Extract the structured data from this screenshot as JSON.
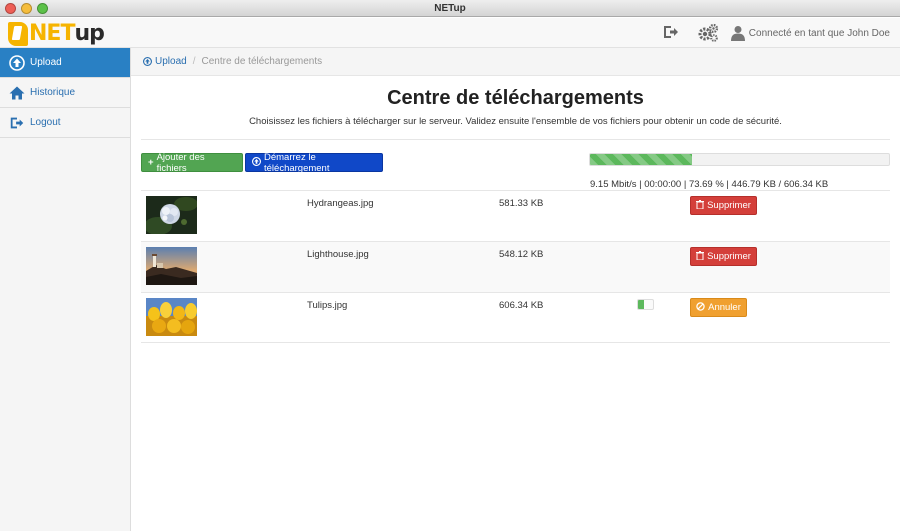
{
  "window": {
    "title": "NETup"
  },
  "header": {
    "logo_a": "NET",
    "logo_b": "up",
    "user_text": "Connecté en tant que John Doe",
    "icons": [
      "logout-icon",
      "gears-icon",
      "user-icon"
    ]
  },
  "sidebar": {
    "items": [
      {
        "label": "Upload",
        "icon": "upload-circle-icon",
        "active": true
      },
      {
        "label": "Historique",
        "icon": "home-icon",
        "active": false
      },
      {
        "label": "Logout",
        "icon": "logout-icon",
        "active": false
      }
    ]
  },
  "breadcrumb": {
    "link": "Upload",
    "current": "Centre de téléchargements"
  },
  "main": {
    "title": "Centre de téléchargements",
    "description": "Choisissez les fichiers à télécharger sur le serveur. Validez ensuite l'ensemble de vos fichiers pour obtenir un code de sécurité.",
    "add_button": "Ajouter des fichiers",
    "start_button": "Démarrez le téléchargement",
    "progress": {
      "percent": 34,
      "status_text": "9.15 Mbit/s | 00:00:00 | 73.69 % | 446.79 KB / 606.34 KB"
    },
    "files": [
      {
        "name": "Hydrangeas.jpg",
        "size": "581.33 KB",
        "action": "Supprimer",
        "action_type": "delete",
        "thumb": "hydrangea-thumbnail"
      },
      {
        "name": "Lighthouse.jpg",
        "size": "548.12 KB",
        "action": "Supprimer",
        "action_type": "delete",
        "thumb": "lighthouse-thumbnail"
      },
      {
        "name": "Tulips.jpg",
        "size": "606.34 KB",
        "action": "Annuler",
        "action_type": "cancel",
        "thumb": "tulips-thumbnail",
        "upload_percent": 40
      }
    ]
  },
  "colors": {
    "primary": "#2980c4",
    "success": "#52a552",
    "start": "#1048c8",
    "danger": "#d43f3a",
    "warning": "#f0a030",
    "logo_yellow": "#f6b400"
  }
}
